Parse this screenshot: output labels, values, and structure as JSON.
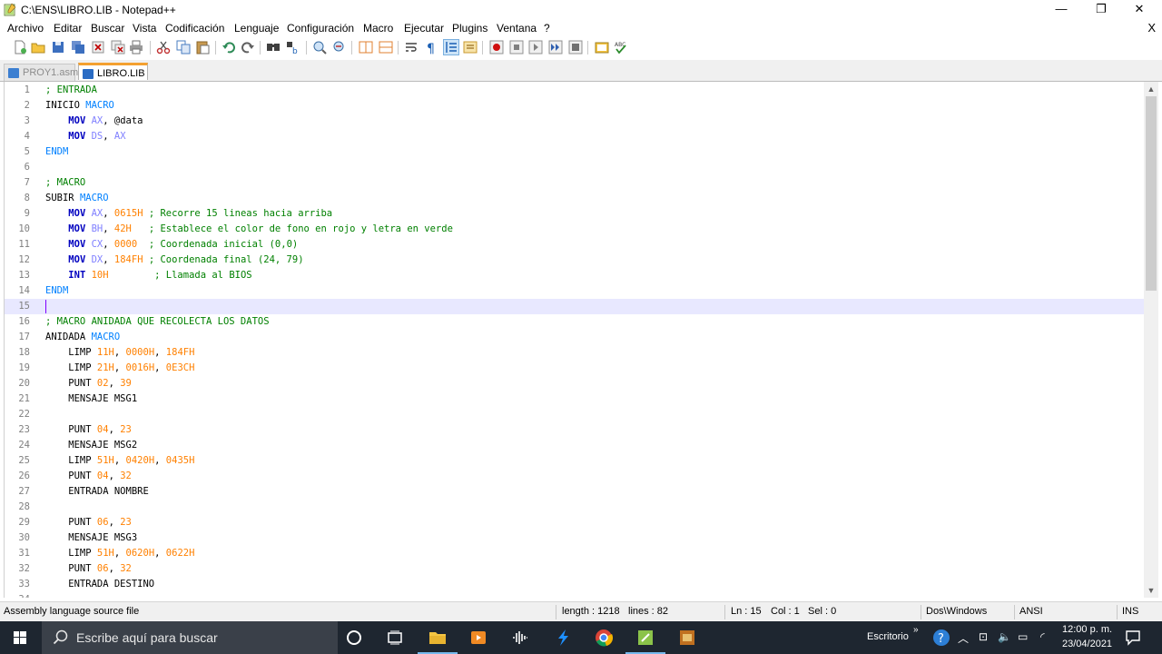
{
  "window": {
    "title": "C:\\ENS\\LIBRO.LIB - Notepad++",
    "minimize": "—",
    "restore": "❐",
    "close": "✕"
  },
  "menu": {
    "items": [
      "Archivo",
      "Editar",
      "Buscar",
      "Vista",
      "Codificación",
      "Lenguaje",
      "Configuración",
      "Macro",
      "Ejecutar",
      "Plugins",
      "Ventana",
      "?"
    ],
    "close": "X"
  },
  "toolbar": {
    "icons": [
      "new-file-icon",
      "open-file-icon",
      "save-icon",
      "save-all-icon",
      "close-icon",
      "close-all-icon",
      "print-icon",
      "cut-icon",
      "copy-icon",
      "paste-icon",
      "undo-icon",
      "redo-icon",
      "find-icon",
      "replace-icon",
      "zoom-in-icon",
      "zoom-out-icon",
      "sync-vertical-icon",
      "sync-horizontal-icon",
      "word-wrap-icon",
      "show-all-chars-icon",
      "indent-guide-icon",
      "function-list-icon",
      "record-macro-icon",
      "stop-macro-icon",
      "play-macro-icon",
      "run-macro-multiple-icon",
      "save-macro-icon",
      "launch-browser-icon",
      "spell-check-icon"
    ]
  },
  "tabs": [
    {
      "label": "PROY1.asm",
      "active": false
    },
    {
      "label": "LIBRO.LIB",
      "active": true
    }
  ],
  "editor": {
    "current_line": 15,
    "lines": [
      [
        [
          "c",
          "; ENTRADA"
        ]
      ],
      [
        [
          "p",
          "INICIO "
        ],
        [
          "d",
          "MACRO"
        ]
      ],
      [
        [
          "p",
          "    "
        ],
        [
          "k",
          "MOV"
        ],
        [
          "p",
          " "
        ],
        [
          "r",
          "AX"
        ],
        [
          "p",
          ", @data"
        ]
      ],
      [
        [
          "p",
          "    "
        ],
        [
          "k",
          "MOV"
        ],
        [
          "p",
          " "
        ],
        [
          "r",
          "DS"
        ],
        [
          "p",
          ", "
        ],
        [
          "r",
          "AX"
        ]
      ],
      [
        [
          "d",
          "ENDM"
        ]
      ],
      [],
      [
        [
          "c",
          "; MACRO"
        ]
      ],
      [
        [
          "p",
          "SUBIR "
        ],
        [
          "d",
          "MACRO"
        ]
      ],
      [
        [
          "p",
          "    "
        ],
        [
          "k",
          "MOV"
        ],
        [
          "p",
          " "
        ],
        [
          "r",
          "AX"
        ],
        [
          "p",
          ", "
        ],
        [
          "n",
          "0615H"
        ],
        [
          "p",
          " "
        ],
        [
          "c",
          "; Recorre 15 lineas hacia arriba"
        ]
      ],
      [
        [
          "p",
          "    "
        ],
        [
          "k",
          "MOV"
        ],
        [
          "p",
          " "
        ],
        [
          "r",
          "BH"
        ],
        [
          "p",
          ", "
        ],
        [
          "n",
          "42H"
        ],
        [
          "p",
          "   "
        ],
        [
          "c",
          "; Establece el color de fono en rojo y letra en verde"
        ]
      ],
      [
        [
          "p",
          "    "
        ],
        [
          "k",
          "MOV"
        ],
        [
          "p",
          " "
        ],
        [
          "r",
          "CX"
        ],
        [
          "p",
          ", "
        ],
        [
          "n",
          "0000"
        ],
        [
          "p",
          "  "
        ],
        [
          "c",
          "; Coordenada inicial (0,0)"
        ]
      ],
      [
        [
          "p",
          "    "
        ],
        [
          "k",
          "MOV"
        ],
        [
          "p",
          " "
        ],
        [
          "r",
          "DX"
        ],
        [
          "p",
          ", "
        ],
        [
          "n",
          "184FH"
        ],
        [
          "p",
          " "
        ],
        [
          "c",
          "; Coordenada final (24, 79)"
        ]
      ],
      [
        [
          "p",
          "    "
        ],
        [
          "k",
          "INT"
        ],
        [
          "p",
          " "
        ],
        [
          "n",
          "10H"
        ],
        [
          "p",
          "        "
        ],
        [
          "c",
          "; Llamada al BIOS"
        ]
      ],
      [
        [
          "d",
          "ENDM"
        ]
      ],
      [],
      [
        [
          "c",
          "; MACRO ANIDADA QUE RECOLECTA LOS DATOS"
        ]
      ],
      [
        [
          "p",
          "ANIDADA "
        ],
        [
          "d",
          "MACRO"
        ]
      ],
      [
        [
          "p",
          "    LIMP "
        ],
        [
          "n",
          "11H"
        ],
        [
          "p",
          ", "
        ],
        [
          "n",
          "0000H"
        ],
        [
          "p",
          ", "
        ],
        [
          "n",
          "184FH"
        ]
      ],
      [
        [
          "p",
          "    LIMP "
        ],
        [
          "n",
          "21H"
        ],
        [
          "p",
          ", "
        ],
        [
          "n",
          "0016H"
        ],
        [
          "p",
          ", "
        ],
        [
          "n",
          "0E3CH"
        ]
      ],
      [
        [
          "p",
          "    PUNT "
        ],
        [
          "n",
          "02"
        ],
        [
          "p",
          ", "
        ],
        [
          "n",
          "39"
        ]
      ],
      [
        [
          "p",
          "    MENSAJE MSG1"
        ]
      ],
      [],
      [
        [
          "p",
          "    PUNT "
        ],
        [
          "n",
          "04"
        ],
        [
          "p",
          ", "
        ],
        [
          "n",
          "23"
        ]
      ],
      [
        [
          "p",
          "    MENSAJE MSG2"
        ]
      ],
      [
        [
          "p",
          "    LIMP "
        ],
        [
          "n",
          "51H"
        ],
        [
          "p",
          ", "
        ],
        [
          "n",
          "0420H"
        ],
        [
          "p",
          ", "
        ],
        [
          "n",
          "0435H"
        ]
      ],
      [
        [
          "p",
          "    PUNT "
        ],
        [
          "n",
          "04"
        ],
        [
          "p",
          ", "
        ],
        [
          "n",
          "32"
        ]
      ],
      [
        [
          "p",
          "    ENTRADA NOMBRE"
        ]
      ],
      [],
      [
        [
          "p",
          "    PUNT "
        ],
        [
          "n",
          "06"
        ],
        [
          "p",
          ", "
        ],
        [
          "n",
          "23"
        ]
      ],
      [
        [
          "p",
          "    MENSAJE MSG3"
        ]
      ],
      [
        [
          "p",
          "    LIMP "
        ],
        [
          "n",
          "51H"
        ],
        [
          "p",
          ", "
        ],
        [
          "n",
          "0620H"
        ],
        [
          "p",
          ", "
        ],
        [
          "n",
          "0622H"
        ]
      ],
      [
        [
          "p",
          "    PUNT "
        ],
        [
          "n",
          "06"
        ],
        [
          "p",
          ", "
        ],
        [
          "n",
          "32"
        ]
      ],
      [
        [
          "p",
          "    ENTRADA DESTINO"
        ]
      ],
      []
    ]
  },
  "status": {
    "file_type": "Assembly language source file",
    "length": "length : 1218",
    "lines": "lines : 82",
    "ln": "Ln : 15",
    "col": "Col : 1",
    "sel": "Sel : 0",
    "eol": "Dos\\Windows",
    "encoding": "ANSI",
    "mode": "INS"
  },
  "taskbar": {
    "search_placeholder": "Escribe aquí para buscar",
    "desktop_label": "Escritorio",
    "time": "12:00 p. m.",
    "date": "23/04/2021"
  },
  "colors": {
    "comment": "#008000",
    "keyword": "#0000c0",
    "register": "#8080ff",
    "number": "#ff8000",
    "directive": "#0080ff",
    "current_line": "#e8e8ff",
    "tab_accent": "#f4a030",
    "taskbar": "#1e2630"
  }
}
